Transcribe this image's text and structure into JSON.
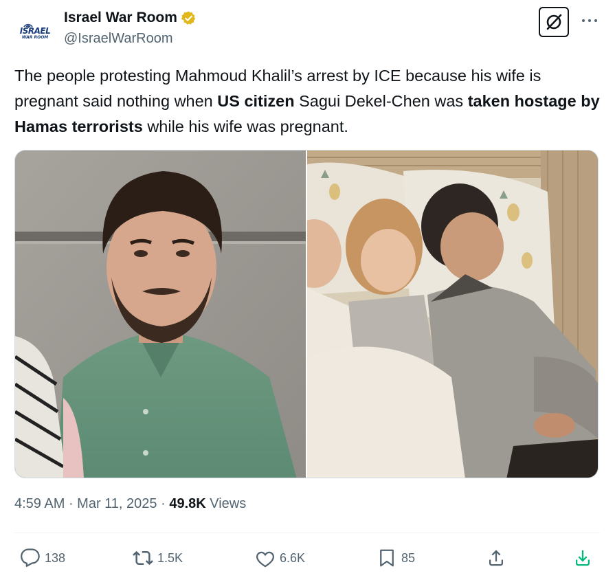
{
  "author": {
    "display_name": "Israel War Room",
    "handle": "@IsraelWarRoom",
    "avatar_text_top": "ISRAEL",
    "avatar_text_bottom": "WAR ROOM",
    "verified_color": "#e2b719"
  },
  "tweet": {
    "parts": [
      {
        "text": "The people protesting Mahmoud Khalil’s arrest by ICE because his wife is pregnant said nothing when ",
        "bold": false
      },
      {
        "text": "US citizen",
        "bold": true
      },
      {
        "text": " Sagui Dekel-Chen was ",
        "bold": false
      },
      {
        "text": "taken hostage by Hamas terrorists",
        "bold": true
      },
      {
        "text": " while his wife was pregnant.",
        "bold": false
      }
    ]
  },
  "meta": {
    "time": "4:59 AM",
    "sep1": " · ",
    "date": "Mar 11, 2025",
    "sep2": " · ",
    "views_count": "49.8K",
    "views_label": " Views"
  },
  "actions": {
    "replies": "138",
    "reposts": "1.5K",
    "likes": "6.6K",
    "bookmarks": "85"
  },
  "icons": {
    "reply": "reply-icon",
    "repost": "repost-icon",
    "like": "heart-icon",
    "bookmark": "bookmark-icon",
    "share": "share-icon",
    "download": "download-icon",
    "grok": "grok-icon",
    "more": "more-icon"
  },
  "colors": {
    "text_primary": "#0f1419",
    "text_secondary": "#536471",
    "download_accent": "#00ba7c",
    "border": "#cfd9de"
  }
}
